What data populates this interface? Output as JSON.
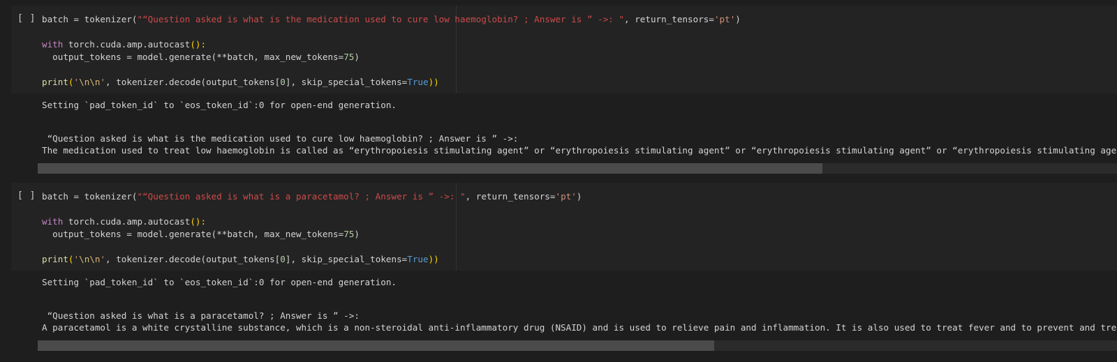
{
  "cells": [
    {
      "run_label": "[ ]",
      "code": {
        "l1_a": "batch = tokenizer(",
        "l1_str": "\"“Question asked is what is the medication used to cure low haemoglobin? ; Answer is ” ->: \"",
        "l1_b": ", return_tensors=",
        "l1_str2": "'pt'",
        "l1_c": ")",
        "l2_kw": "with",
        "l2_a": " torch.cuda.amp.autocast",
        "l2_b": "():",
        "l3_a": "  output_tokens = model.generate",
        "l3_b": "(**batch, max_new_tokens=",
        "l3_num": "75",
        "l3_c": ")",
        "l4_fn": "print",
        "l4_p1": "(",
        "l4_str": "'",
        "l4_esc": "\\n\\n",
        "l4_str_end": "'",
        "l4_a": ", tokenizer.decode(output_tokens[",
        "l4_num": "0",
        "l4_b": "], skip_special_tokens=",
        "l4_bool": "True",
        "l4_c": "))"
      },
      "output": {
        "warning": "Setting `pad_token_id` to `eos_token_id`:0 for open-end generation.",
        "question": " “Question asked is what is the medication used to cure low haemoglobin? ; Answer is ” ->:",
        "answer": "The medication used to treat low haemoglobin is called as “erythropoiesis stimulating agent” or “erythropoiesis stimulating agent” or “erythropoiesis stimulating agent” or “erythropoiesis stimulating agent”"
      },
      "scroll_fraction": 0.727
    },
    {
      "run_label": "[ ]",
      "code": {
        "l1_a": "batch = tokenizer(",
        "l1_str": "\"“Question asked is what is a paracetamol? ; Answer is ” ->: \"",
        "l1_b": ", return_tensors=",
        "l1_str2": "'pt'",
        "l1_c": ")",
        "l2_kw": "with",
        "l2_a": " torch.cuda.amp.autocast",
        "l2_b": "():",
        "l3_a": "  output_tokens = model.generate",
        "l3_b": "(**batch, max_new_tokens=",
        "l3_num": "75",
        "l3_c": ")",
        "l4_fn": "print",
        "l4_p1": "(",
        "l4_str": "'",
        "l4_esc": "\\n\\n",
        "l4_str_end": "'",
        "l4_a": ", tokenizer.decode(output_tokens[",
        "l4_num": "0",
        "l4_b": "], skip_special_tokens=",
        "l4_bool": "True",
        "l4_c": "))"
      },
      "output": {
        "warning": "Setting `pad_token_id` to `eos_token_id`:0 for open-end generation.",
        "question": " “Question asked is what is a paracetamol? ; Answer is ” ->:",
        "answer": "A paracetamol is a white crystalline substance, which is a non-steroidal anti-inflammatory drug (NSAID) and is used to relieve pain and inflammation. It is also used to treat fever and to prevent and treat"
      },
      "scroll_fraction": 0.627
    }
  ]
}
